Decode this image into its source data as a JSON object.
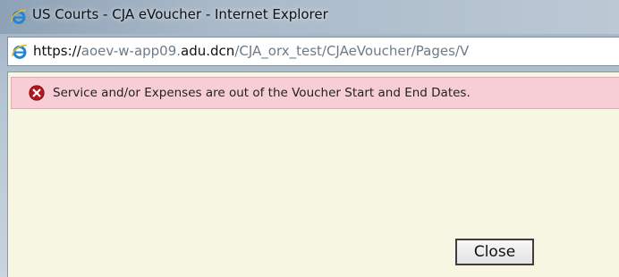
{
  "window": {
    "title": "US Courts - CJA eVoucher - Internet Explorer"
  },
  "address_bar": {
    "scheme": "https://",
    "host_prefix": "aoev-w-app09.",
    "domain": "adu.dcn",
    "path": "/CJA_orx_test/CJAeVoucher/Pages/V"
  },
  "error": {
    "message": "Service and/or Expenses are out of the Voucher Start and End Dates.",
    "icon": "error-x-icon"
  },
  "actions": {
    "close_label": "Close"
  },
  "colors": {
    "error_background": "#f8ced6",
    "content_background": "#f6f6e2",
    "error_icon": "#b3171e",
    "ie_icon": "#1f86d6"
  }
}
